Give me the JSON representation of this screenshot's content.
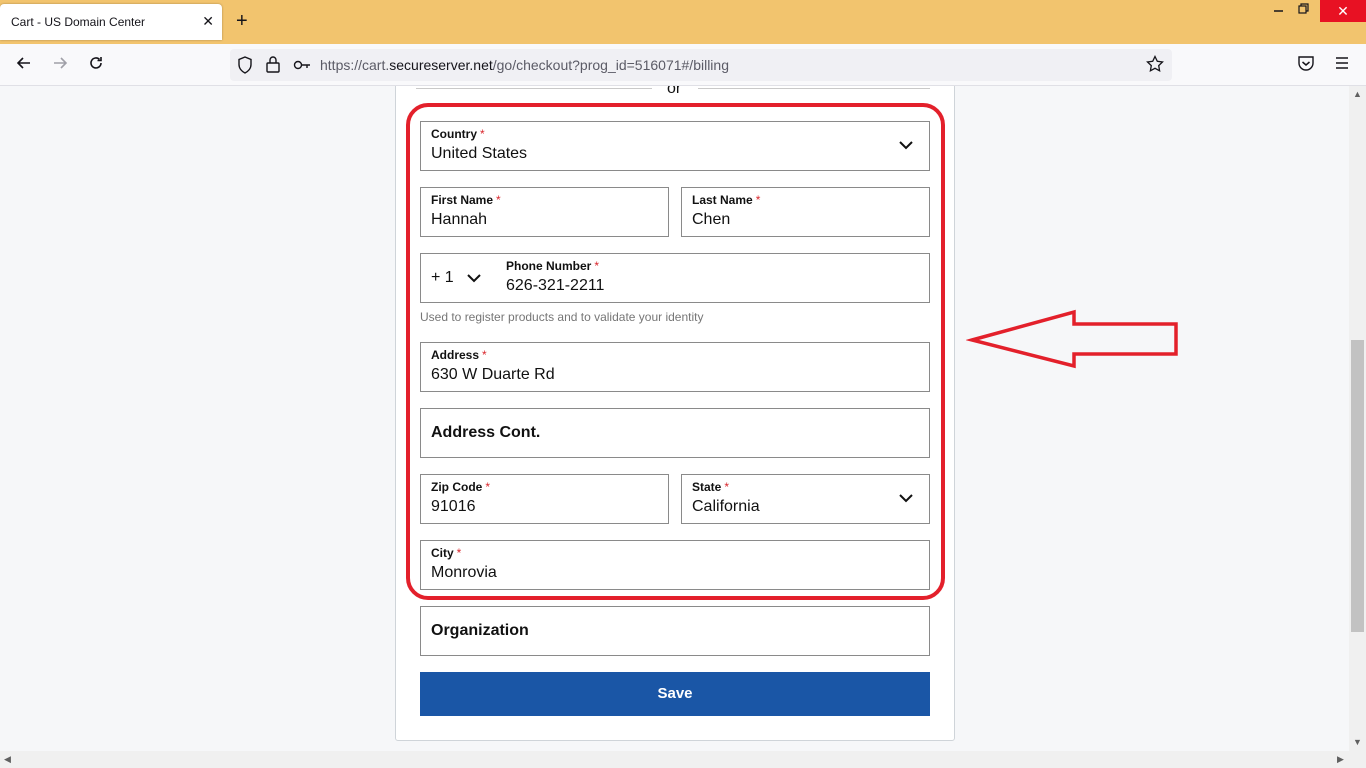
{
  "browser": {
    "tab_title": "Cart - US Domain Center",
    "tab_close": "✕",
    "new_tab": "+",
    "url_prefix": "https://cart.",
    "url_domain": "secureserver.net",
    "url_path": "/go/checkout?prog_id=516071#/billing"
  },
  "form": {
    "divider_text": "or",
    "required_mark": "*",
    "country": {
      "label": "Country",
      "value": "United States"
    },
    "first_name": {
      "label": "First Name",
      "value": "Hannah"
    },
    "last_name": {
      "label": "Last Name",
      "value": "Chen"
    },
    "phone": {
      "code": "+ 1",
      "label": "Phone Number",
      "value": "626-321-2211",
      "helper": "Used to register products and to validate your identity"
    },
    "address": {
      "label": "Address",
      "value": "630 W Duarte Rd"
    },
    "address_cont": {
      "placeholder": "Address Cont."
    },
    "zip": {
      "label": "Zip Code",
      "value": "91016"
    },
    "state": {
      "label": "State",
      "value": "California"
    },
    "city": {
      "label": "City",
      "value": "Monrovia"
    },
    "organization": {
      "placeholder": "Organization"
    },
    "save_label": "Save"
  },
  "colors": {
    "accent": "#1a56a6",
    "highlight": "#e3202b",
    "tabbar": "#f2c46e"
  }
}
